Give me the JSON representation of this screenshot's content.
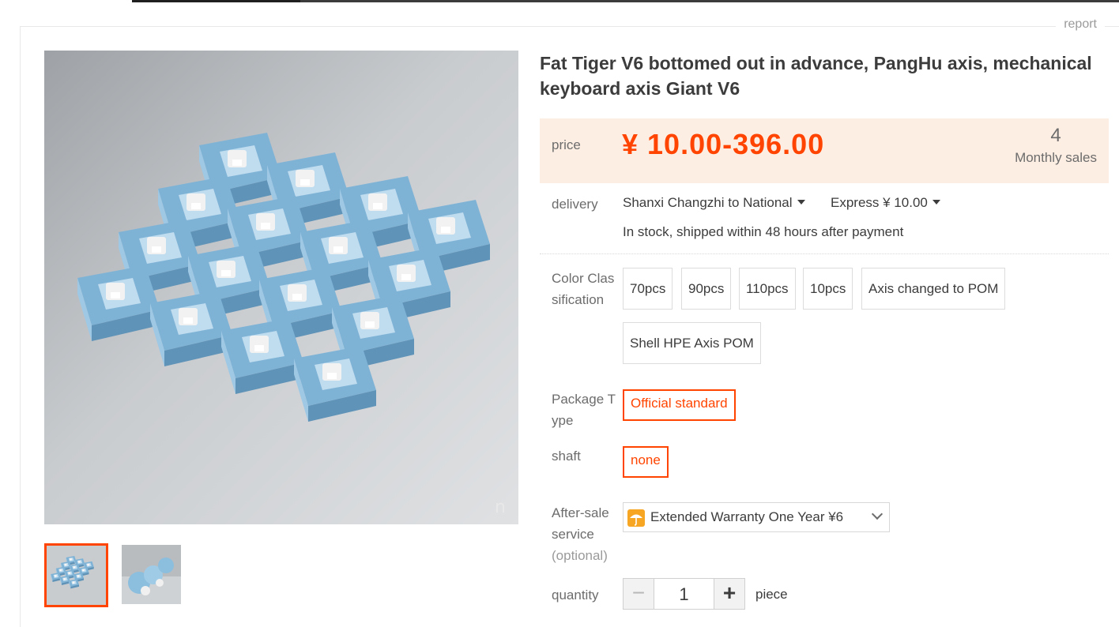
{
  "header": {
    "report_label": "report"
  },
  "product": {
    "title": "Fat Tiger V6 bottomed out in advance, PangHu axis, mechanical keyboard axis Giant V6",
    "price_label": "price",
    "price": "¥ 10.00-396.00",
    "monthly_sales_count": "4",
    "monthly_sales_label": "Monthly sales",
    "image_watermark": "n"
  },
  "delivery": {
    "label": "delivery",
    "route": "Shanxi Changzhi to National",
    "fee": "Express ¥ 10.00",
    "stock_note": "In stock, shipped within 48 hours after payment"
  },
  "color_classification": {
    "label_line1": "Color Clas",
    "label_line2": "sification",
    "options": [
      "70pcs",
      "90pcs",
      "110pcs",
      "10pcs",
      "Axis changed to POM",
      "Shell HPE Axis POM"
    ]
  },
  "package_type": {
    "label_line1": "Package T",
    "label_line2": "ype",
    "selected": "Official standard"
  },
  "shaft": {
    "label": "shaft",
    "selected": "none"
  },
  "after_sale": {
    "label_line1": "After-sale",
    "label_line2": "service",
    "label_line3": "(optional)",
    "selected": "Extended Warranty One Year ¥6"
  },
  "quantity": {
    "label": "quantity",
    "minus": "−",
    "plus": "+",
    "value": "1",
    "unit": "piece"
  },
  "colors": {
    "accent": "#ff4400",
    "price_bg": "#fdeee3",
    "text": "#3c3c3c",
    "muted": "#6c6c6c"
  }
}
